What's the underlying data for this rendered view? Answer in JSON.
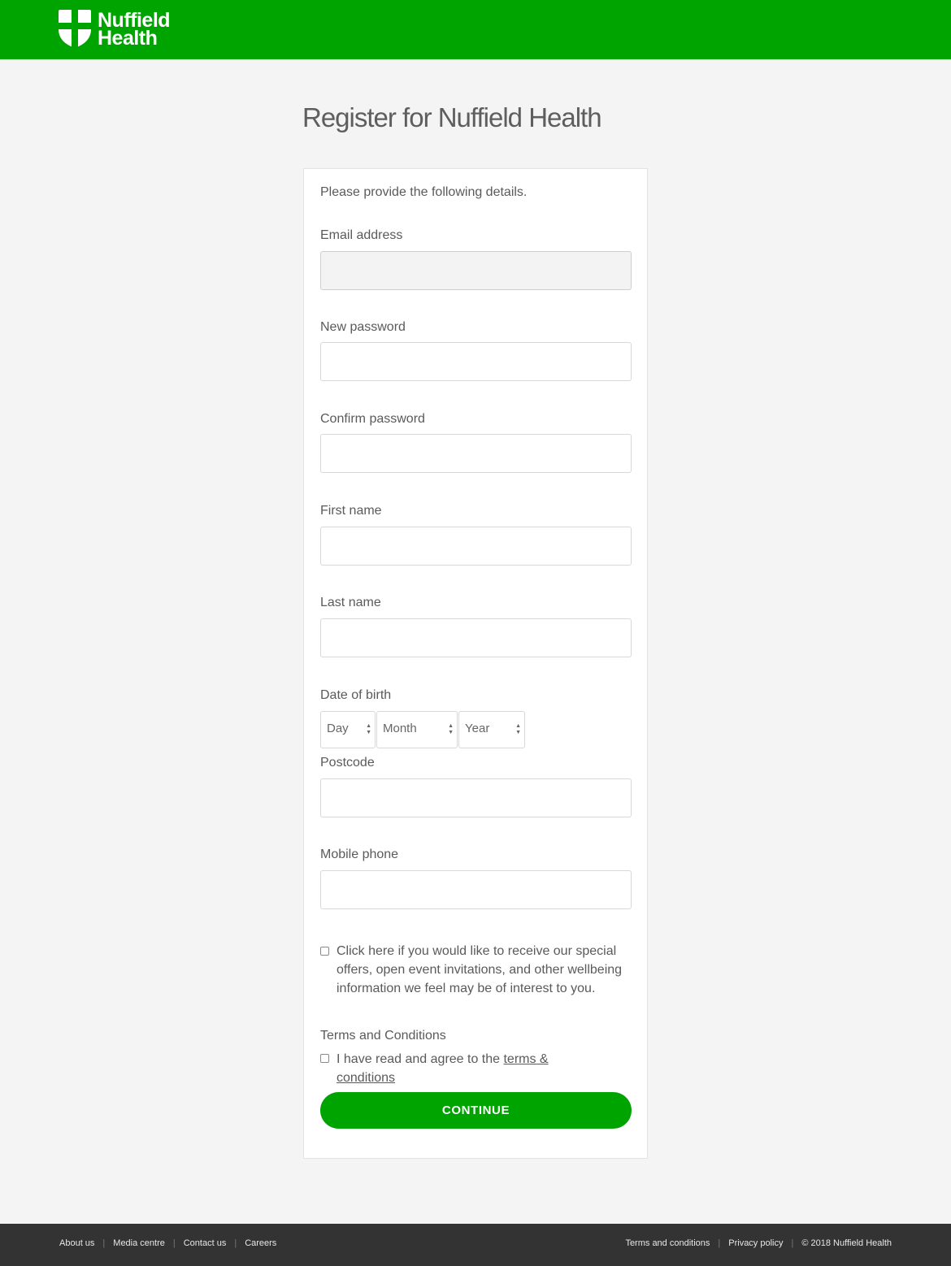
{
  "header": {
    "logo_line1": "Nuffield",
    "logo_line2": "Health",
    "brand_color": "#00a400"
  },
  "page_title": "Register for Nuffield Health",
  "form": {
    "intro": "Please provide the following details.",
    "email_label": "Email address",
    "email_value": "",
    "new_password_label": "New password",
    "confirm_password_label": "Confirm password",
    "first_name_label": "First name",
    "last_name_label": "Last name",
    "dob_label": "Date of birth",
    "dob_day": "Day",
    "dob_month": "Month",
    "dob_year": "Year",
    "postcode_label": "Postcode",
    "mobile_label": "Mobile phone",
    "marketing_text": "Click here if you would like to receive our special offers, open event invitations, and other wellbeing information we feel may be of interest to you.",
    "terms_heading": "Terms and Conditions",
    "terms_text": "I have read and agree to the ",
    "terms_link": "terms & conditions",
    "continue_label": "CONTINUE"
  },
  "footer": {
    "left_links": [
      "About us",
      "Media centre",
      "Contact us",
      "Careers"
    ],
    "right_links": [
      "Terms and conditions",
      "Privacy policy"
    ],
    "copyright": "© 2018 Nuffield Health"
  }
}
